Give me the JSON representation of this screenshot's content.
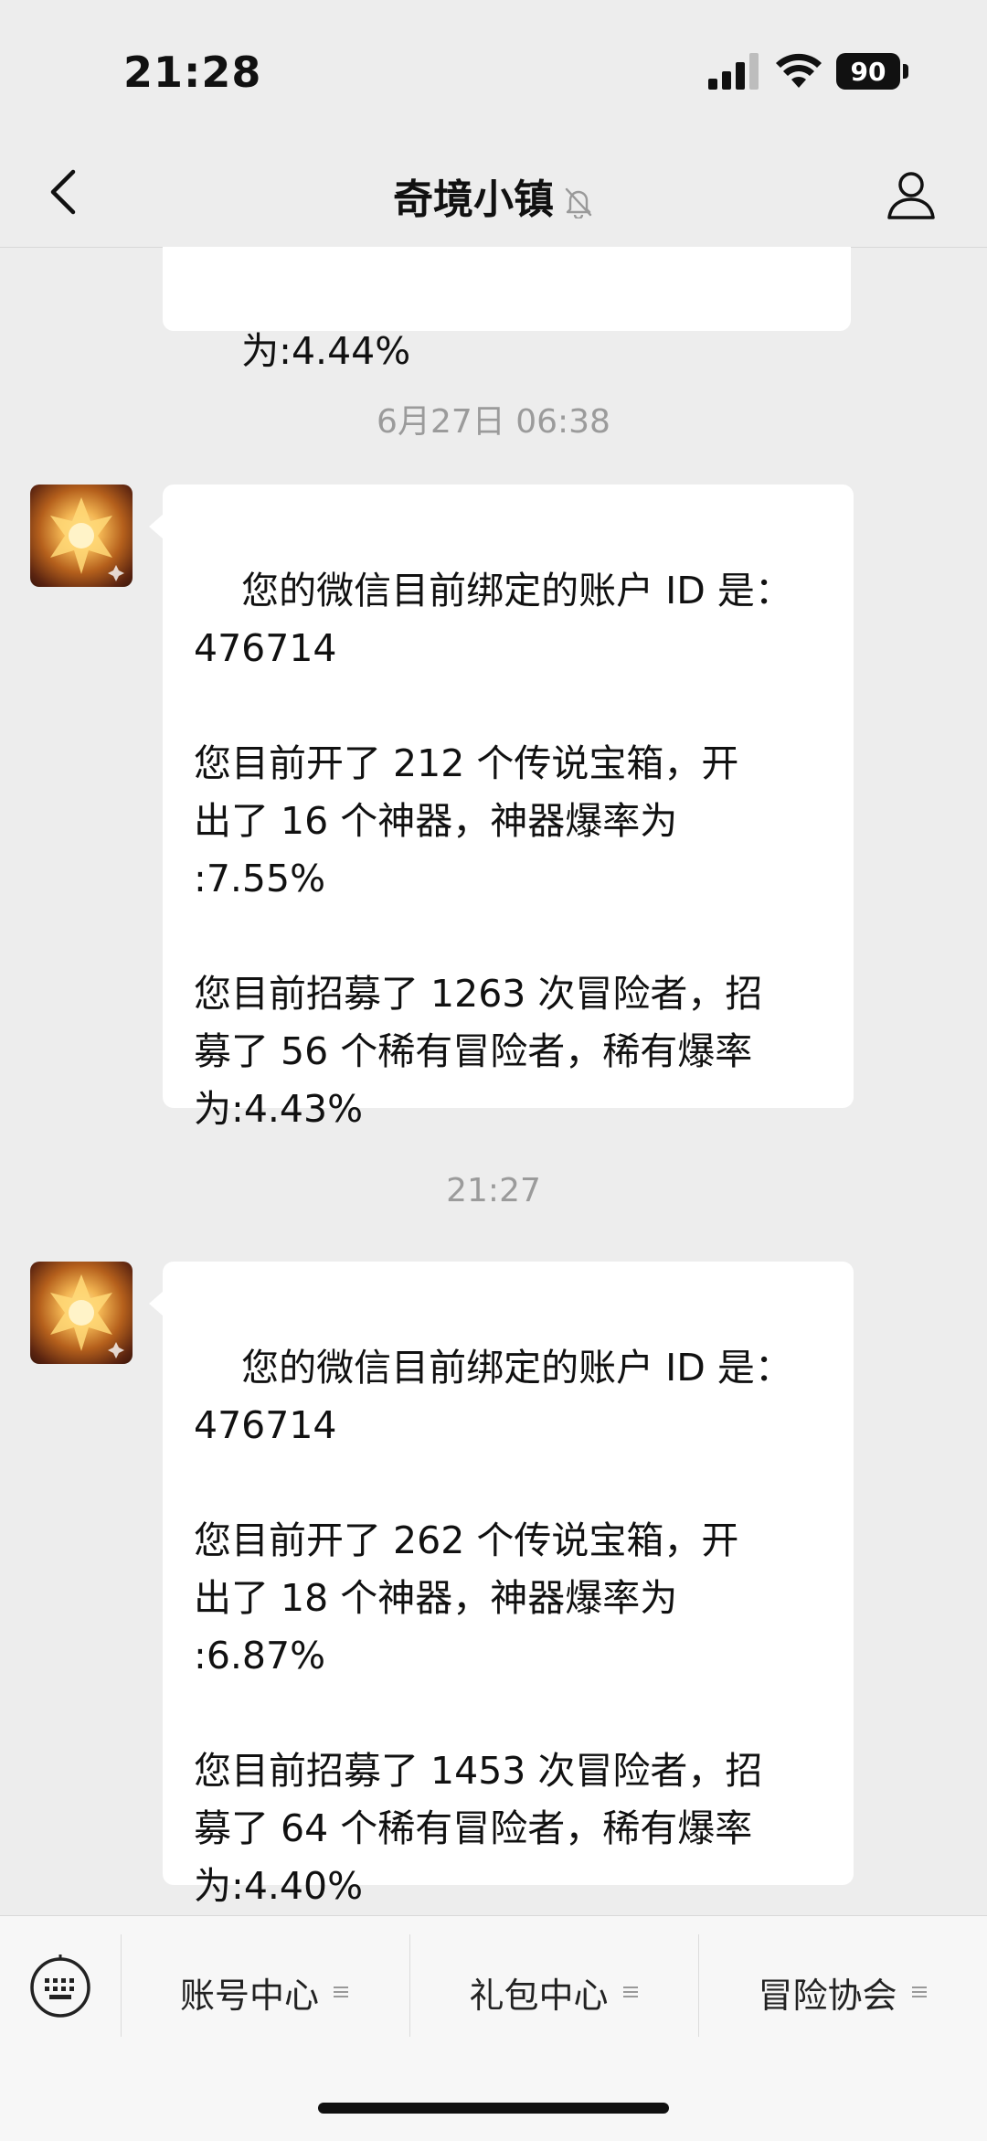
{
  "status_bar": {
    "time": "21:28",
    "battery": "90"
  },
  "nav": {
    "title": "奇境小镇",
    "back_icon": "chevron-left-icon",
    "mute_icon": "bell-off-icon",
    "profile_icon": "person-icon"
  },
  "messages": {
    "prev_tail": "为:4.44%",
    "stamp1": "6月27日 06:38",
    "msg1": "您的微信目前绑定的账户 ID 是：\n476714\n\n您目前开了 212 个传说宝箱，开\n出了 16 个神器，神器爆率为\n:7.55%\n\n您目前招募了 1263 次冒险者，招\n募了 56 个稀有冒险者，稀有爆率\n为:4.43%",
    "stamp2": "21:27",
    "msg2": "您的微信目前绑定的账户 ID 是：\n476714\n\n您目前开了 262 个传说宝箱，开\n出了 18 个神器，神器爆率为\n:6.87%\n\n您目前招募了 1453 次冒险者，招\n募了 64 个稀有冒险者，稀有爆率\n为:4.40%"
  },
  "menu": {
    "keyboard_icon": "keyboard-icon",
    "items": [
      {
        "label": "账号中心"
      },
      {
        "label": "礼包中心"
      },
      {
        "label": "冒险协会"
      }
    ],
    "submenu_icon": "menu-lines-icon"
  }
}
